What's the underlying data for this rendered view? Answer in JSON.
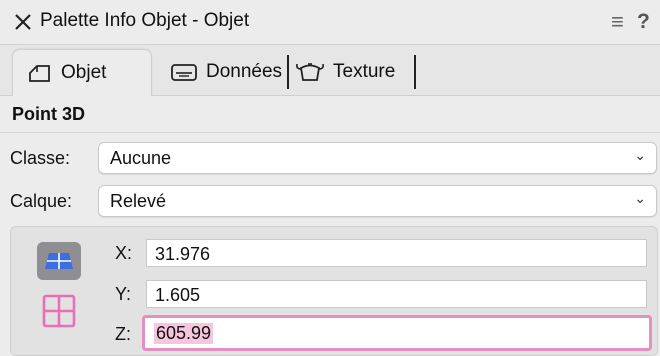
{
  "window": {
    "title": "Palette Info Objet - Objet",
    "close_icon": "close-x-icon",
    "menu_icon": "hamburger-menu-icon",
    "help_label": "?"
  },
  "tabs": [
    {
      "label": "Objet",
      "icon": "object-shape-icon",
      "active": true
    },
    {
      "label": "Données",
      "icon": "data-record-icon",
      "active": false
    },
    {
      "label": "Texture",
      "icon": "teapot-texture-icon",
      "active": false
    }
  ],
  "object": {
    "type_title": "Point 3D"
  },
  "fields": {
    "classe": {
      "label": "Classe:",
      "value": "Aucune"
    },
    "calque": {
      "label": "Calque:",
      "value": "Relevé"
    }
  },
  "coordinates": {
    "x": {
      "label": "X:",
      "value": "31.976"
    },
    "y": {
      "label": "Y:",
      "value": "1.605"
    },
    "z": {
      "label": "Z:",
      "value": "605.99"
    }
  },
  "colors": {
    "focus_ring": "#e48fc3",
    "mode_active_bg": "#8e8e93",
    "mode_grid_icon": "#e86fb8",
    "mode_plane_icon": "#3b6fe0"
  }
}
